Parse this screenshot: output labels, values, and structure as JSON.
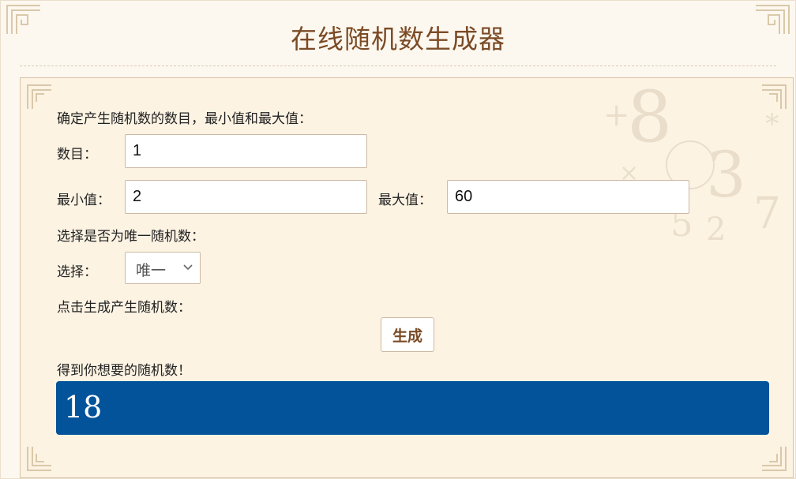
{
  "header": {
    "title": "在线随机数生成器"
  },
  "form": {
    "intro": "确定产生随机数的数目，最小值和最大值：",
    "count": {
      "label": "数目：",
      "value": "1"
    },
    "min": {
      "label": "最小值：",
      "value": "2"
    },
    "max": {
      "label": "最大值：",
      "value": "60"
    },
    "unique_prompt": "选择是否为唯一随机数：",
    "select": {
      "label": "选择：",
      "selected": "唯一"
    },
    "generate_prompt": "点击生成产生随机数：",
    "generate_button": "生成",
    "result_prompt": "得到你想要的随机数！",
    "result_value": "18"
  },
  "colors": {
    "title": "#7a4b26",
    "result_bg": "#03539a",
    "panel_bg": "#fcf3e3"
  },
  "decor": {
    "icons": [
      "ornamental-corner-icon",
      "numbers-background-icon"
    ]
  }
}
